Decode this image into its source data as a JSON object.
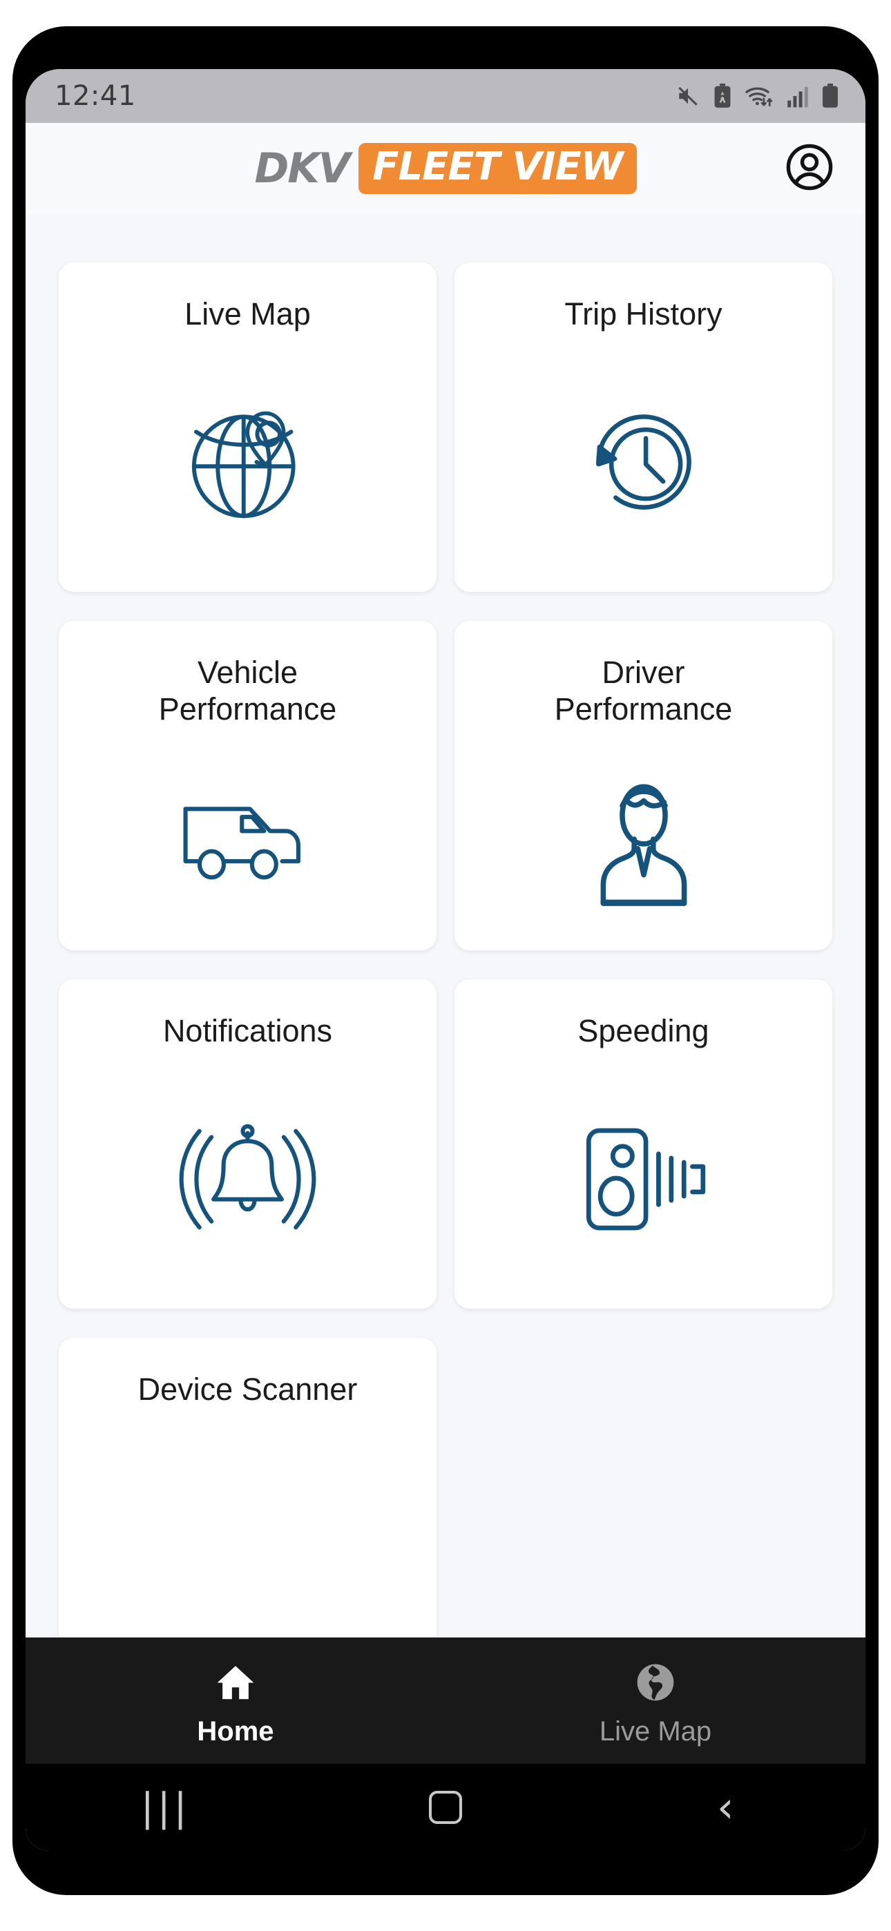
{
  "status_bar": {
    "time": "12:41",
    "icons": [
      "mute-icon",
      "battery-saver-icon",
      "wifi-icon",
      "cellular-signal-icon",
      "battery-icon"
    ]
  },
  "header": {
    "logo_text": "DKV",
    "logo_badge_text": "FLEET VIEW",
    "account_icon": "account-circle-icon",
    "brand_orange": "#f08a33",
    "brand_gray": "#808285"
  },
  "main": {
    "icon_color": "#15537d",
    "tiles": [
      {
        "label": "Live Map",
        "icon": "globe-pin-icon"
      },
      {
        "label": "Trip History",
        "icon": "history-clock-icon"
      },
      {
        "label": "Vehicle\nPerformance",
        "icon": "van-icon"
      },
      {
        "label": "Driver\nPerformance",
        "icon": "driver-person-icon"
      },
      {
        "label": "Notifications",
        "icon": "bell-ringing-icon"
      },
      {
        "label": "Speeding",
        "icon": "speed-camera-icon"
      },
      {
        "label": "Device Scanner",
        "icon": "scanner-icon"
      }
    ]
  },
  "bottom_nav": {
    "items": [
      {
        "label": "Home",
        "icon": "home-icon",
        "active": true
      },
      {
        "label": "Live Map",
        "icon": "globe-icon",
        "active": false
      }
    ],
    "active_color": "#ffffff",
    "inactive_color": "#9b9b9b"
  },
  "system_nav": {
    "recents": "|||",
    "home": "home-square-icon",
    "back": "‹"
  }
}
